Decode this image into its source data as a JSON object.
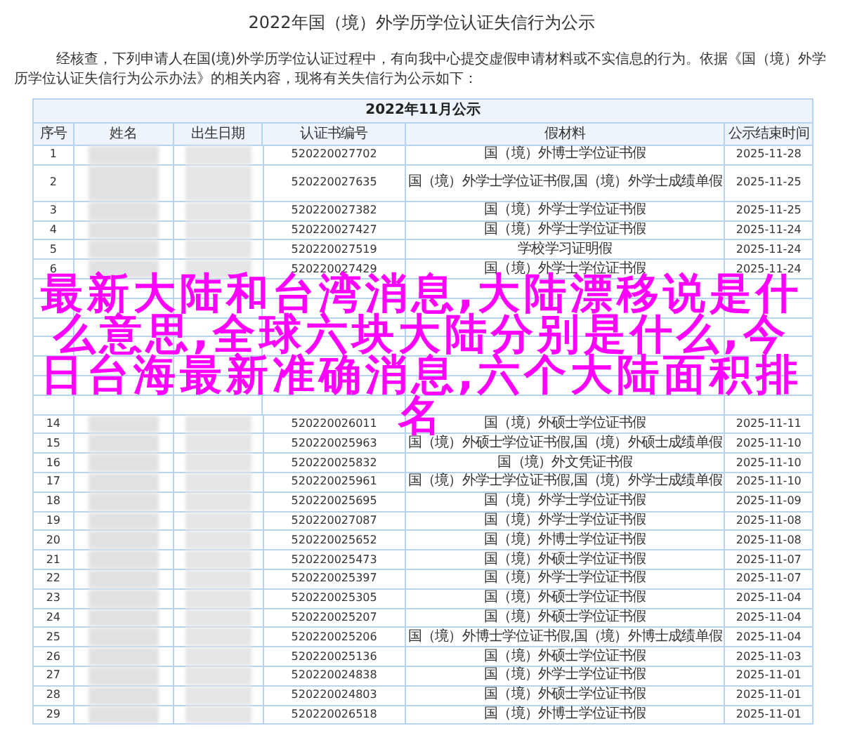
{
  "title": "2022年国（境）外学历学位认证失信行为公示",
  "intro": "经核查，下列申请人在国(境)外学历学位认证过程中，有向我中心提交虚假申请材料或不实信息的行为。依据《国（境）外学历学位认证失信行为公示办法》的相关内容，现将有关失信行为公示如下：",
  "table": {
    "caption": "2022年11月公示",
    "columns": [
      "序号",
      "姓名",
      "出生日期",
      "认证书编号",
      "假材料",
      "公示结束时间"
    ],
    "rows": [
      {
        "kind": "row",
        "no": "1",
        "cert": "520220027702",
        "material": "国（境）外博士学位证书假",
        "end": "2025-11-28"
      },
      {
        "kind": "tall_row",
        "no": "2",
        "cert": "520220027635",
        "material": "国（境）外学士学位证书假,国（境）外学士成绩单假",
        "end": "2025-11-25"
      },
      {
        "kind": "row",
        "no": "3",
        "cert": "520220027382",
        "material": "国（境）外学士学位证书假",
        "end": "2025-11-25"
      },
      {
        "kind": "row",
        "no": "4",
        "cert": "520220027427",
        "material": "国（境）外学士学位证书假",
        "end": "2025-11-24"
      },
      {
        "kind": "row",
        "no": "5",
        "cert": "520220027519",
        "material": "学校学习证明假",
        "end": "2025-11-24"
      },
      {
        "kind": "row",
        "no": "6",
        "cert": "520220027429",
        "material": "国（境）外学士学位证书假",
        "end": "2025-11-24"
      },
      {
        "kind": "covered"
      },
      {
        "kind": "covered"
      },
      {
        "kind": "covered"
      },
      {
        "kind": "covered"
      },
      {
        "kind": "covered"
      },
      {
        "kind": "covered"
      },
      {
        "kind": "covered"
      },
      {
        "kind": "row",
        "no": "14",
        "cert": "520220026011",
        "material": "国（境）外硕士学位证书假",
        "end": "2025-11-11"
      },
      {
        "kind": "row",
        "no": "15",
        "cert": "520220025963",
        "material": "国（境）外硕士学位证书假,国（境）外硕士成绩单假",
        "end": "2025-11-10"
      },
      {
        "kind": "row",
        "no": "16",
        "cert": "520220025832",
        "material": "国（境）外文凭证书假",
        "end": "2025-11-10"
      },
      {
        "kind": "row",
        "no": "17",
        "cert": "520220025961",
        "material": "国（境）外学士学位证书假,国（境）外学士成绩单假",
        "end": "2025-11-10"
      },
      {
        "kind": "row",
        "no": "18",
        "cert": "520220025695",
        "material": "国（境）外学士学位证书假",
        "end": "2025-11-09"
      },
      {
        "kind": "row",
        "no": "19",
        "cert": "520220027087",
        "material": "国（境）外学士学位证书假",
        "end": "2025-11-08"
      },
      {
        "kind": "row",
        "no": "20",
        "cert": "520220025652",
        "material": "国（境）外博士学位证书假",
        "end": "2025-11-08"
      },
      {
        "kind": "row",
        "no": "21",
        "cert": "520220025473",
        "material": "国（境）外硕士学位证书假",
        "end": "2025-11-07"
      },
      {
        "kind": "row",
        "no": "22",
        "cert": "520220025397",
        "material": "国（境）外学士学位证书假",
        "end": "2025-11-07"
      },
      {
        "kind": "row",
        "no": "23",
        "cert": "520220025305",
        "material": "国（境）外硕士学位证书假",
        "end": "2025-11-04"
      },
      {
        "kind": "row",
        "no": "24",
        "cert": "520220025207",
        "material": "国（境）外硕士学位证书假",
        "end": "2025-11-04"
      },
      {
        "kind": "row",
        "no": "25",
        "cert": "520220025206",
        "material": "国（境）外博士学位证书假,国（境）外博士成绩单假",
        "end": "2025-11-04"
      },
      {
        "kind": "row",
        "no": "26",
        "cert": "520220025136",
        "material": "国（境）外硕士学位证书假",
        "end": "2025-11-03"
      },
      {
        "kind": "row",
        "no": "27",
        "cert": "520220024838",
        "material": "国（境）外学士学位证书假",
        "end": "2025-11-01"
      },
      {
        "kind": "row",
        "no": "28",
        "cert": "520220024803",
        "material": "国（境）外硕士学位证书假",
        "end": "2025-11-01"
      },
      {
        "kind": "row",
        "no": "29",
        "cert": "520220026518",
        "material": "国（境）外博士学位证书假",
        "end": "2025-11-01"
      }
    ]
  },
  "overlay_headline": [
    "最新大陆和台湾消息,大陆漂移说是什",
    "么意思,全球六块大陆分别是什么,今",
    "日台海最新准确消息,六个大陆面积排",
    "名"
  ]
}
